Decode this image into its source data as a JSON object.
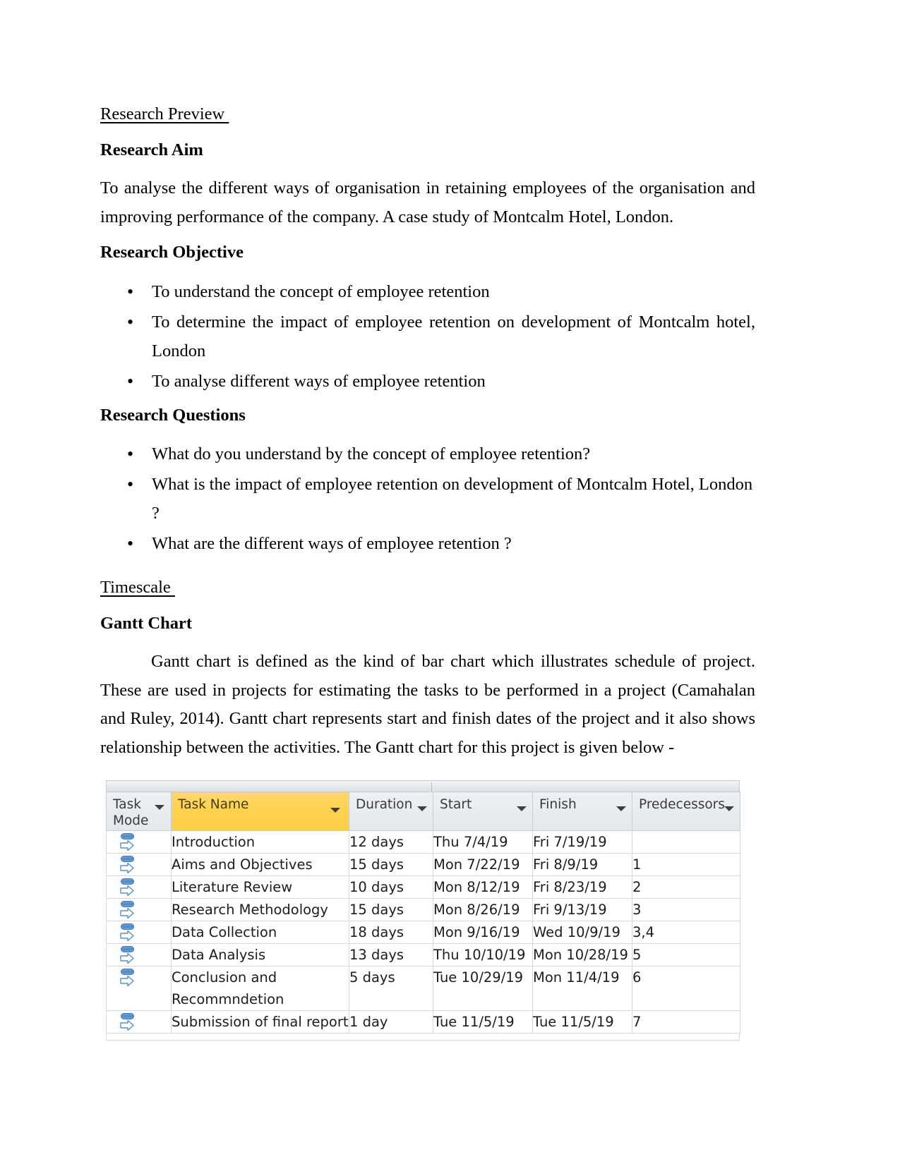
{
  "document": {
    "section_title": "Research Preview ",
    "timescale_title": "Timescale "
  },
  "research_aim": {
    "heading": "Research Aim",
    "body": "To analyse the different ways of organisation in retaining employees of the organisation and improving performance of the company. A case study of Montcalm Hotel, London."
  },
  "research_objective": {
    "heading": "Research Objective",
    "items": [
      "To understand the concept of employee retention",
      "To determine the impact of  employee retention on development of Montcalm hotel, London",
      "To analyse different ways of employee retention"
    ]
  },
  "research_questions": {
    "heading": "Research Questions",
    "items": [
      "What do you understand by the concept of employee retention?",
      "What is the impact of employee retention on development of Montcalm Hotel, London ?",
      "What are the different ways of employee retention ?"
    ]
  },
  "gantt_section": {
    "heading": "Gantt Chart",
    "body": "Gantt chart is defined as the kind of bar chart which illustrates schedule of project. These are used in projects for estimating the tasks to be performed in a project (Camahalan and Ruley, 2014). Gantt chart represents start and finish dates of the project and it also shows relationship between the activities. The Gantt chart for this project is given below -"
  },
  "chart_data": {
    "type": "table",
    "title": "Gantt Chart",
    "columns": [
      {
        "label": "Task Mode",
        "sortable": true,
        "highlighted": false
      },
      {
        "label": "Task Name",
        "sortable": true,
        "highlighted": true
      },
      {
        "label": "Duration",
        "sortable": true,
        "highlighted": false
      },
      {
        "label": "Start",
        "sortable": true,
        "highlighted": false
      },
      {
        "label": "Finish",
        "sortable": true,
        "highlighted": false
      },
      {
        "label": "Predecessors",
        "sortable": true,
        "highlighted": false
      }
    ],
    "highlight_color": "#ffd24f",
    "rows": [
      {
        "mode_icon": "manually-scheduled-icon",
        "name": "Introduction",
        "duration": "12 days",
        "start": "Thu 7/4/19",
        "finish": "Fri 7/19/19",
        "predecessors": ""
      },
      {
        "mode_icon": "manually-scheduled-icon",
        "name": "Aims and Objectives",
        "duration": "15 days",
        "start": "Mon 7/22/19",
        "finish": "Fri 8/9/19",
        "predecessors": "1"
      },
      {
        "mode_icon": "manually-scheduled-icon",
        "name": "Literature Review",
        "duration": "10 days",
        "start": "Mon 8/12/19",
        "finish": "Fri 8/23/19",
        "predecessors": "2"
      },
      {
        "mode_icon": "manually-scheduled-icon",
        "name": "Research Methodology",
        "duration": "15 days",
        "start": "Mon 8/26/19",
        "finish": "Fri 9/13/19",
        "predecessors": "3"
      },
      {
        "mode_icon": "manually-scheduled-icon",
        "name": "Data Collection",
        "duration": "18 days",
        "start": "Mon 9/16/19",
        "finish": "Wed 10/9/19",
        "predecessors": "3,4"
      },
      {
        "mode_icon": "manually-scheduled-icon",
        "name": "Data Analysis",
        "duration": "13 days",
        "start": "Thu 10/10/19",
        "finish": "Mon 10/28/19",
        "predecessors": "5"
      },
      {
        "mode_icon": "manually-scheduled-icon",
        "name": "Conclusion and Recommndetion",
        "duration": "5 days",
        "start": "Tue 10/29/19",
        "finish": "Mon 11/4/19",
        "predecessors": "6"
      },
      {
        "mode_icon": "manually-scheduled-icon",
        "name": "Submission of final report",
        "duration": "1 day",
        "start": "Tue 11/5/19",
        "finish": "Tue 11/5/19",
        "predecessors": "7"
      }
    ]
  }
}
